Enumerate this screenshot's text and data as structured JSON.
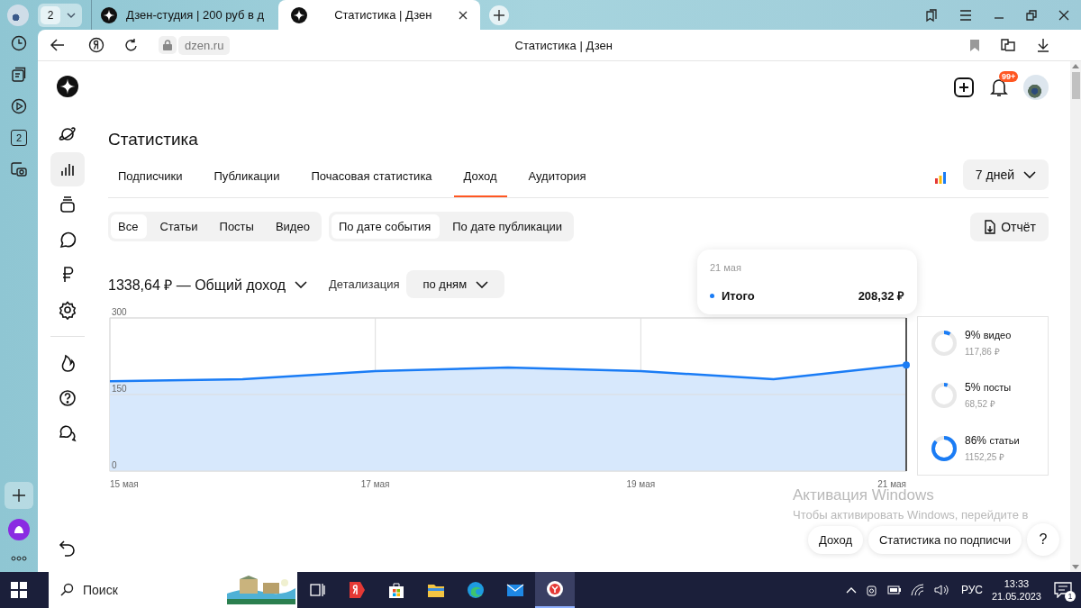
{
  "browser": {
    "tab_count": "2",
    "tabs": [
      {
        "title": "Дзен-студия | 200 руб в д",
        "selected": false
      },
      {
        "title": "Статистика | Дзен",
        "selected": true
      }
    ],
    "address": "dzen.ru",
    "page_title": "Статистика | Дзен",
    "side_items": [
      {
        "kind": "history"
      },
      {
        "kind": "feed"
      },
      {
        "kind": "video"
      },
      {
        "kind": "count",
        "label": "2"
      },
      {
        "kind": "screenshot"
      }
    ]
  },
  "header": {
    "notifications_badge": "99+"
  },
  "sidebar": {
    "groups": [
      {
        "items": [
          {
            "kind": "planet",
            "selected": false
          },
          {
            "kind": "stats",
            "selected": true
          },
          {
            "kind": "stack",
            "selected": false
          },
          {
            "kind": "comment",
            "selected": false
          },
          {
            "kind": "ruble",
            "selected": false
          },
          {
            "kind": "gear",
            "selected": false
          }
        ]
      },
      {
        "items": [
          {
            "kind": "fire",
            "selected": false
          },
          {
            "kind": "help",
            "selected": false
          },
          {
            "kind": "chats",
            "selected": false
          }
        ]
      }
    ]
  },
  "page": {
    "title": "Статистика",
    "tabs": [
      {
        "label": "Подписчики",
        "selected": false
      },
      {
        "label": "Публикации",
        "selected": false
      },
      {
        "label": "Почасовая статистика",
        "selected": false
      },
      {
        "label": "Доход",
        "selected": true
      },
      {
        "label": "Аудитория",
        "selected": false
      }
    ],
    "period": "7 дней",
    "type_filters": [
      {
        "label": "Все",
        "selected": true
      },
      {
        "label": "Статьи",
        "selected": false
      },
      {
        "label": "Посты",
        "selected": false
      },
      {
        "label": "Видео",
        "selected": false
      }
    ],
    "date_filters": [
      {
        "label": "По дате события",
        "selected": true
      },
      {
        "label": "По дате публикации",
        "selected": false
      }
    ],
    "report_button": "Отчёт",
    "total": "1338,64 ₽ — Общий доход",
    "detail_label": "Детализация",
    "detail_value": "по дням",
    "chart_data": {
      "type": "area",
      "x": [
        15,
        16,
        17,
        18,
        19,
        20,
        21
      ],
      "xlim": [
        15,
        21
      ],
      "xticks": [
        {
          "value": 15,
          "label": "15 мая"
        },
        {
          "value": 17,
          "label": "17 мая"
        },
        {
          "value": 19,
          "label": "19 мая"
        },
        {
          "value": 21,
          "label": "21 мая"
        }
      ],
      "ylim": [
        0,
        300
      ],
      "yticks": [
        0,
        150,
        300
      ],
      "grid": true,
      "series": [
        {
          "name": "Итого",
          "color": "#1a7cf5",
          "values": [
            176,
            180,
            196,
            203,
            196,
            180,
            208
          ]
        }
      ]
    },
    "tooltip": {
      "date": "21 мая",
      "value": "208,32 ₽"
    },
    "breakdown": [
      {
        "percent": "9%",
        "label": "видео",
        "amount": "117,86 ₽"
      },
      {
        "percent": "5%",
        "label": "посты",
        "amount": "68,52 ₽"
      },
      {
        "percent": "86%",
        "label": "статьи",
        "amount": "1152,25 ₽"
      }
    ],
    "floating_buttons": [
      "Доход",
      "Статистика по подписчи",
      "?"
    ]
  },
  "os_notice": {
    "title": "Активация Windows",
    "text": "Чтобы активировать Windows, перейдите в"
  },
  "taskbar": {
    "search_placeholder": "Поиск",
    "apps": [
      {
        "kind": "taskview",
        "selected": false
      },
      {
        "kind": "yandex",
        "selected": false
      },
      {
        "kind": "store",
        "selected": false
      },
      {
        "kind": "folder",
        "selected": false
      },
      {
        "kind": "edge",
        "selected": false
      },
      {
        "kind": "mail",
        "selected": false
      },
      {
        "kind": "yabrowser",
        "selected": true
      }
    ],
    "language": "РУС",
    "time": "13:33",
    "date": "21.05.2023",
    "notification_count": "1"
  }
}
